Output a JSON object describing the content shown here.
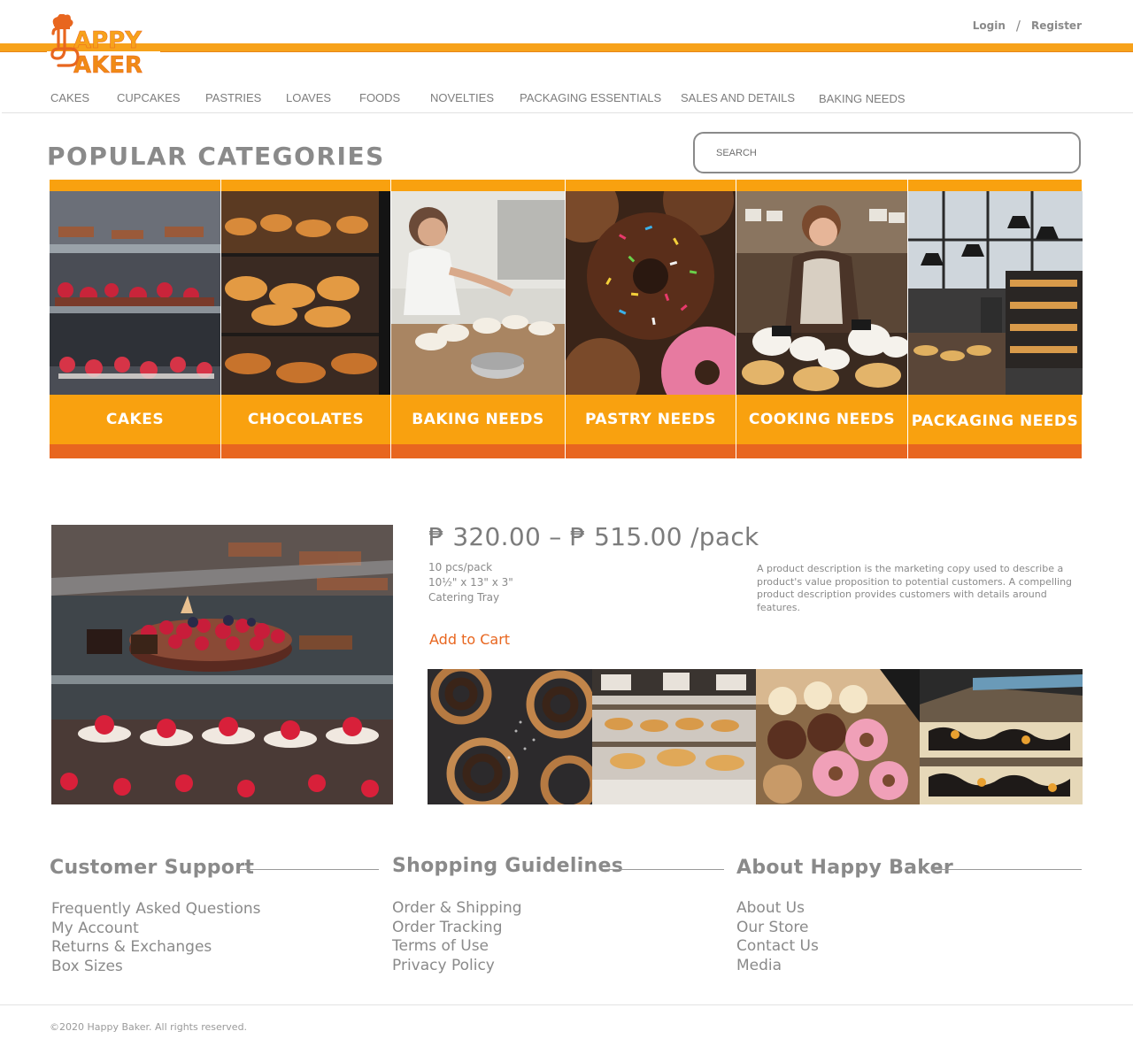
{
  "brand": {
    "name": "Happy Baker",
    "logo_lines": [
      "APPY",
      "AKER"
    ]
  },
  "auth": {
    "login": "Login",
    "separator": "/",
    "register": "Register"
  },
  "nav": {
    "items": [
      "CAKES",
      "CUPCAKES",
      "PASTRIES",
      "LOAVES",
      "FOODS",
      "NOVELTIES",
      "PACKAGING ESSENTIALS",
      "SALES AND DETAILS",
      "BAKING NEEDS"
    ]
  },
  "categories": {
    "title": "POPULAR CATEGORIES",
    "search_placeholder": "SEARCH",
    "items": [
      {
        "label": "CAKES"
      },
      {
        "label": "CHOCOLATES"
      },
      {
        "label": "BAKING NEEDS"
      },
      {
        "label": "PASTRY NEEDS"
      },
      {
        "label": "COOKING NEEDS"
      },
      {
        "label": "PACKAGING NEEDS"
      }
    ]
  },
  "product": {
    "price": "₱ 320.00 – ₱ 515.00 /pack",
    "specs": [
      "10 pcs/pack",
      "10½\" x 13\" x 3\"",
      "Catering Tray"
    ],
    "description": "A product description is the marketing copy used to describe a product's value proposition to potential customers. A compelling product description provides customers with details around features.",
    "add_to_cart": "Add to Cart"
  },
  "footer": {
    "support": {
      "title": "Customer Support",
      "links": [
        "Frequently Asked Questions",
        "My Account",
        "Returns & Exchanges",
        "Box Sizes"
      ]
    },
    "guidelines": {
      "title": "Shopping Guidelines",
      "links": [
        "Order & Shipping",
        "Order Tracking",
        "Terms of Use",
        "Privacy Policy"
      ]
    },
    "about": {
      "title": "About Happy Baker",
      "links": [
        "About Us",
        "Our Store",
        "Contact Us",
        "Media"
      ]
    },
    "copyright": "©2020 Happy Baker. All rights reserved."
  },
  "colors": {
    "accent": "#f9a10f",
    "accent_dark": "#e8661f",
    "text": "#7a7a7a"
  }
}
